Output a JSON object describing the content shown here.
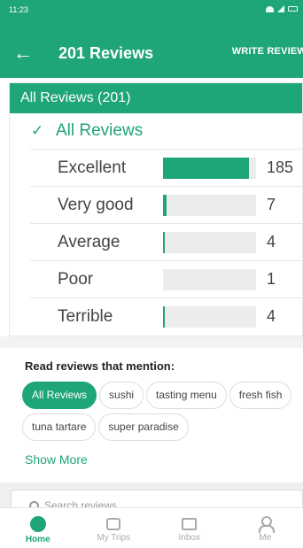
{
  "status_bar": {
    "time": "11:23"
  },
  "app_bar": {
    "back_icon": "arrow-left-icon",
    "title": "201 Reviews",
    "write_review": "WRITE REVIEW"
  },
  "panel": {
    "header": "All Reviews (201)",
    "all_reviews_label": "All Reviews",
    "check_icon": "checkmark-icon",
    "ratings": [
      {
        "label": "Excellent",
        "count": "185",
        "fill_fraction": 0.92
      },
      {
        "label": "Very good",
        "count": "7",
        "fill_fraction": 0.035
      },
      {
        "label": "Average",
        "count": "4",
        "fill_fraction": 0.02
      },
      {
        "label": "Poor",
        "count": "1",
        "fill_fraction": 0.0
      },
      {
        "label": "Terrible",
        "count": "4",
        "fill_fraction": 0.02
      }
    ]
  },
  "mention": {
    "title": "Read reviews that mention:",
    "chips": [
      {
        "label": "All Reviews",
        "active": true
      },
      {
        "label": "sushi",
        "active": false
      },
      {
        "label": "tasting menu",
        "active": false
      },
      {
        "label": "fresh fish",
        "active": false
      },
      {
        "label": "tuna tartare",
        "active": false
      },
      {
        "label": "super paradise",
        "active": false
      }
    ],
    "show_more": "Show More"
  },
  "search": {
    "placeholder": "Search reviews"
  },
  "bottom_nav": [
    {
      "label": "Home",
      "icon": "home-compass-icon",
      "active": true
    },
    {
      "label": "My Trips",
      "icon": "trips-icon",
      "active": false
    },
    {
      "label": "Inbox",
      "icon": "inbox-icon",
      "active": false
    },
    {
      "label": "Me",
      "icon": "profile-icon",
      "active": false
    }
  ],
  "colors": {
    "accent": "#1fa57a",
    "bar_bg": "#ececec"
  }
}
